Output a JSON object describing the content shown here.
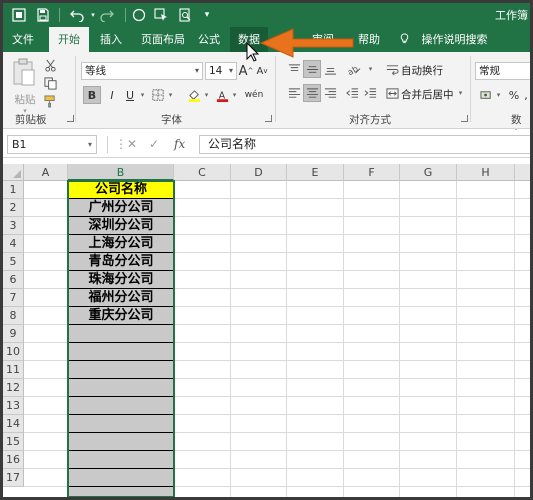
{
  "title": "工作簿",
  "ribbon_tabs": [
    "文件",
    "开始",
    "插入",
    "页面布局",
    "公式",
    "数据",
    "审阅",
    "帮助"
  ],
  "active_tab": "开始",
  "hovered_tab": "数据",
  "tell_me": "操作说明搜索",
  "groups": {
    "clipboard": {
      "label": "剪贴板",
      "paste": "粘贴"
    },
    "font": {
      "label": "字体",
      "font_name": "等线",
      "font_size": "14",
      "bold": "B",
      "italic": "I",
      "underline": "U"
    },
    "alignment": {
      "label": "对齐方式",
      "wrap_text": "自动换行",
      "merge_center": "合并后居中"
    },
    "number": {
      "label": "数字",
      "format": "常规",
      "percent": "%"
    }
  },
  "formula_bar": {
    "name_box": "B1",
    "fx": "fx",
    "content": "公司名称"
  },
  "columns": [
    "A",
    "B",
    "C",
    "D",
    "E",
    "F",
    "G",
    "H"
  ],
  "rows": [
    "1",
    "2",
    "3",
    "4",
    "5",
    "6",
    "7",
    "8",
    "9",
    "10",
    "11",
    "12",
    "13",
    "14",
    "15",
    "16",
    "17"
  ],
  "cells_B": [
    "公司名称",
    "广州分公司",
    "深圳分公司",
    "上海分公司",
    "青岛分公司",
    "珠海分公司",
    "福州分公司",
    "重庆分公司"
  ],
  "colors": {
    "excel_green": "#217346",
    "header_fill": "#ffff00",
    "arrow": "#e8731c"
  }
}
